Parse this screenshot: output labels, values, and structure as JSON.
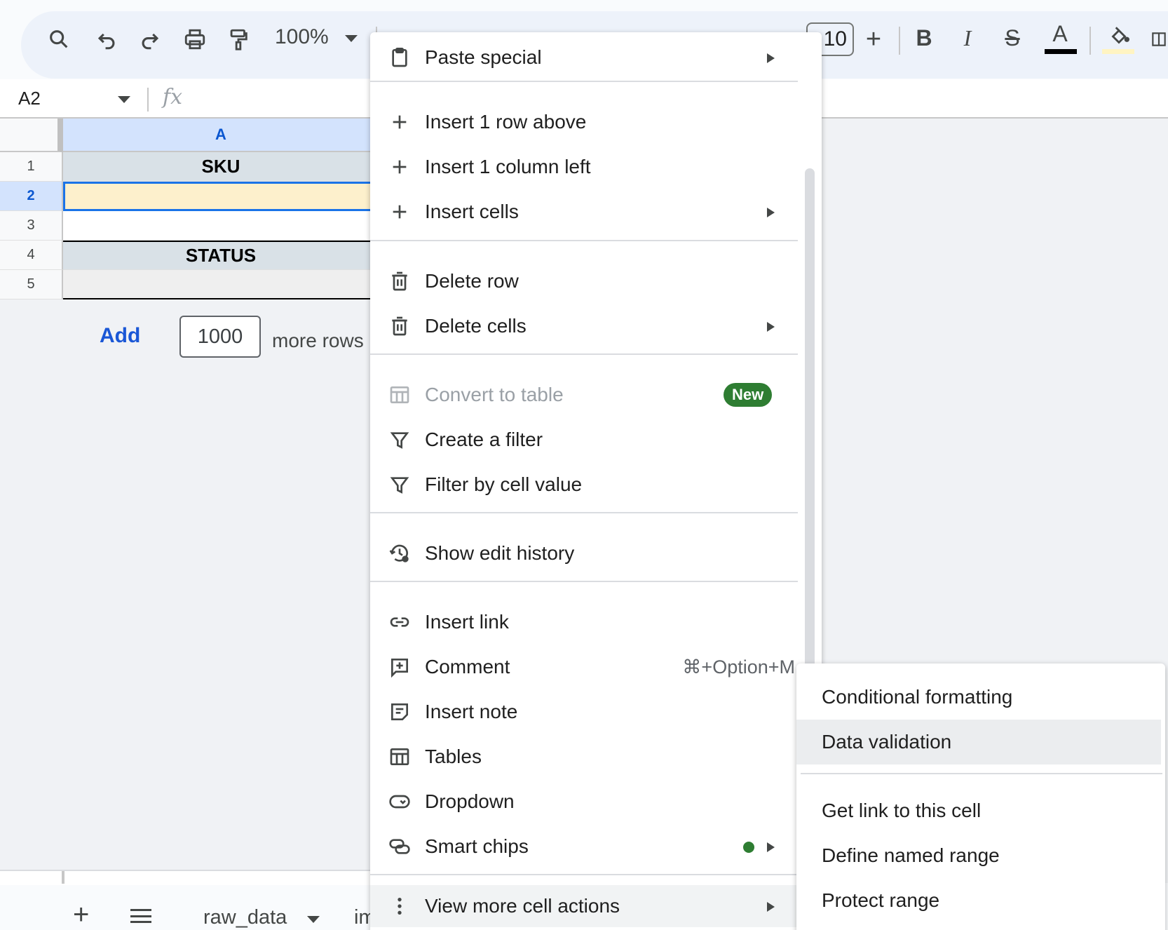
{
  "toolbar": {
    "zoom": "100%",
    "font_size": "10",
    "bold_label": "B",
    "italic_label": "I",
    "strike_label": "S",
    "text_color_label": "A",
    "text_color": "#000000",
    "fill_color": "#fff4c2"
  },
  "formula_bar": {
    "cell_ref": "A2",
    "fx_label": "fx",
    "value": ""
  },
  "grid": {
    "column_header": "A",
    "rows": [
      {
        "num": "1",
        "value": "SKU"
      },
      {
        "num": "2",
        "value": ""
      },
      {
        "num": "3",
        "value": ""
      },
      {
        "num": "4",
        "value": "STATUS"
      },
      {
        "num": "5",
        "value": ""
      }
    ],
    "add_label": "Add",
    "add_rows_value": "1000",
    "more_rows_label": "more rows"
  },
  "sheets": {
    "tabs": [
      "raw_data",
      "im"
    ]
  },
  "context_menu": {
    "items": [
      {
        "label": "Paste special",
        "icon": "clipboard-icon",
        "submenu": true
      },
      {
        "label": "Insert 1 row above",
        "icon": "plus-icon"
      },
      {
        "label": "Insert 1 column left",
        "icon": "plus-icon"
      },
      {
        "label": "Insert cells",
        "icon": "plus-icon",
        "submenu": true
      },
      {
        "label": "Delete row",
        "icon": "trash-icon"
      },
      {
        "label": "Delete cells",
        "icon": "trash-icon",
        "submenu": true
      },
      {
        "label": "Convert to table",
        "icon": "table-icon",
        "disabled": true,
        "badge": "New"
      },
      {
        "label": "Create a filter",
        "icon": "filter-icon"
      },
      {
        "label": "Filter by cell value",
        "icon": "filter-icon"
      },
      {
        "label": "Show edit history",
        "icon": "history-icon"
      },
      {
        "label": "Insert link",
        "icon": "link-icon"
      },
      {
        "label": "Comment",
        "icon": "comment-icon",
        "shortcut": "⌘+Option+M"
      },
      {
        "label": "Insert note",
        "icon": "note-icon"
      },
      {
        "label": "Tables",
        "icon": "table-icon"
      },
      {
        "label": "Dropdown",
        "icon": "dropdown-icon"
      },
      {
        "label": "Smart chips",
        "icon": "smart-chips-icon",
        "submenu": true
      },
      {
        "label": "View more cell actions",
        "icon": "more-vert-icon",
        "submenu": true,
        "highlighted": true
      }
    ],
    "badge_color": "#2e7d32"
  },
  "submenu": {
    "items": [
      {
        "label": "Conditional formatting"
      },
      {
        "label": "Data validation",
        "highlighted": true
      },
      {
        "label": "Get link to this cell"
      },
      {
        "label": "Define named range"
      },
      {
        "label": "Protect range"
      }
    ]
  }
}
